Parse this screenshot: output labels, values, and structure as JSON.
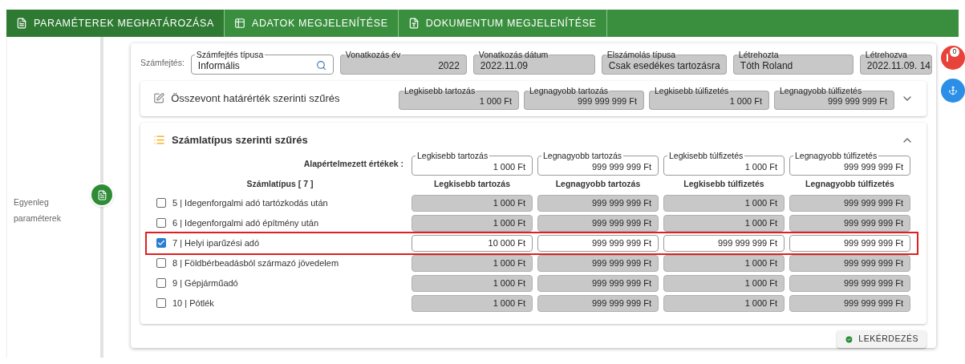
{
  "tabs": [
    {
      "label": "PARAMÉTEREK MEGHATÁROZÁSA",
      "selected": true
    },
    {
      "label": "ADATOK MEGJELENÍTÉSE",
      "selected": false
    },
    {
      "label": "DOKUMENTUM MEGJELENÍTÉSE",
      "selected": false
    }
  ],
  "sidebar": {
    "step_label": "Egyenleg paraméterek"
  },
  "header": {
    "label": "Számfejtés:",
    "fields": [
      {
        "label": "Számfejtés típusa",
        "value": "Informális",
        "disabled": false,
        "kind": "search"
      },
      {
        "label": "Vonatkozás év",
        "value": "2022",
        "disabled": true,
        "kind": "number"
      },
      {
        "label": "Vonatkozás dátum",
        "value": "2022.11.09",
        "disabled": true,
        "kind": "text"
      },
      {
        "label": "Elszámolás típusa",
        "value": "Csak esedékes tartozásra",
        "disabled": true,
        "kind": "text"
      },
      {
        "label": "Létrehozta",
        "value": "Tóth Roland",
        "disabled": true,
        "kind": "text"
      },
      {
        "label": "Létrehozva",
        "value": "2022.11.09. 14",
        "disabled": true,
        "kind": "text"
      }
    ]
  },
  "summary_section": {
    "title": "Összevont határérték szerinti szűrés",
    "expanded": false,
    "fields": [
      {
        "label": "Legkisebb tartozás",
        "value": "1 000 Ft",
        "disabled": true
      },
      {
        "label": "Legnagyobb tartozás",
        "value": "999 999 999 Ft",
        "disabled": true
      },
      {
        "label": "Legkisebb túlfizetés",
        "value": "1 000 Ft",
        "disabled": true
      },
      {
        "label": "Legnagyobb túlfizetés",
        "value": "999 999 999 Ft",
        "disabled": true
      }
    ]
  },
  "type_section": {
    "title": "Számlatípus szerinti szűrés",
    "expanded": true,
    "defaults_label": "Alapértelmezett értékek :",
    "defaults": [
      {
        "label": "Legkisebb tartozás",
        "value": "1 000 Ft",
        "disabled": false
      },
      {
        "label": "Legnagyobb tartozás",
        "value": "999 999 999 Ft",
        "disabled": false
      },
      {
        "label": "Legkisebb túlfizetés",
        "value": "1 000 Ft",
        "disabled": false
      },
      {
        "label": "Legnagyobb túlfizetés",
        "value": "999 999 999 Ft",
        "disabled": false
      }
    ],
    "columns": [
      "Számlatípus [ 7 ]",
      "Legkisebb tartozás",
      "Legnagyobb tartozás",
      "Legkisebb túlfizetés",
      "Legnagyobb túlfizetés"
    ],
    "rows": [
      {
        "label": "5 | Idegenforgalmi adó tartózkodás után",
        "checked": false,
        "values": [
          "1 000 Ft",
          "999 999 999 Ft",
          "1 000 Ft",
          "999 999 999 Ft"
        ]
      },
      {
        "label": "6 | Idegenforgalmi adó építmény után",
        "checked": false,
        "values": [
          "1 000 Ft",
          "999 999 999 Ft",
          "1 000 Ft",
          "999 999 999 Ft"
        ]
      },
      {
        "label": "7 | Helyi iparűzési adó",
        "checked": true,
        "values": [
          "10 000 Ft",
          "999 999 999 Ft",
          "999 999 999 Ft",
          "999 999 999 Ft"
        ]
      },
      {
        "label": "8 | Földbérbeadásból származó jövedelem",
        "checked": false,
        "values": [
          "1 000 Ft",
          "999 999 999 Ft",
          "1 000 Ft",
          "999 999 999 Ft"
        ]
      },
      {
        "label": "9 | Gépjárműadó",
        "checked": false,
        "values": [
          "1 000 Ft",
          "999 999 999 Ft",
          "1 000 Ft",
          "999 999 999 Ft"
        ]
      },
      {
        "label": "10 | Pótlék",
        "checked": false,
        "values": [
          "1 000 Ft",
          "999 999 999 Ft",
          "1 000 Ft",
          "999 999 999 Ft"
        ]
      }
    ]
  },
  "query_button": "LEKÉRDEZÉS",
  "notification": {
    "count": "0"
  }
}
